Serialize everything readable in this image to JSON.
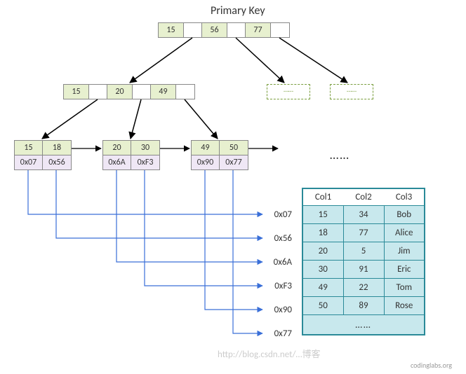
{
  "title": "Primary Key",
  "root_keys": [
    "15",
    "56",
    "77"
  ],
  "internal_keys": [
    "15",
    "20",
    "49"
  ],
  "leaves": [
    {
      "keys": [
        "15",
        "18"
      ],
      "ptrs": [
        "0x07",
        "0x56"
      ]
    },
    {
      "keys": [
        "20",
        "30"
      ],
      "ptrs": [
        "0x6A",
        "0xF3"
      ]
    },
    {
      "keys": [
        "49",
        "50"
      ],
      "ptrs": [
        "0x90",
        "0x77"
      ]
    }
  ],
  "ellipsis_leaf": "……",
  "dashed_label": "……",
  "table": {
    "headers": [
      "Col1",
      "Col2",
      "Col3"
    ],
    "row_labels": [
      "0x07",
      "0x56",
      "0x6A",
      "0xF3",
      "0x90",
      "0x77"
    ],
    "rows": [
      [
        "15",
        "34",
        "Bob"
      ],
      [
        "18",
        "77",
        "Alice"
      ],
      [
        "20",
        "5",
        "Jim"
      ],
      [
        "30",
        "91",
        "Eric"
      ],
      [
        "49",
        "22",
        "Tom"
      ],
      [
        "50",
        "89",
        "Rose"
      ]
    ],
    "footer_ellipsis": "……"
  },
  "watermark": "http://blog.csdn.net/…博客",
  "credit": "codinglabs.org",
  "chart_data": {
    "type": "table",
    "title": "Primary Key B+Tree Secondary-Index -> Row lookup",
    "index_node_keys": {
      "root": [
        15,
        56,
        77
      ],
      "level1_child": [
        15,
        20,
        49
      ]
    },
    "leaf_entries": [
      {
        "key": 15,
        "rowid": "0x07"
      },
      {
        "key": 18,
        "rowid": "0x56"
      },
      {
        "key": 20,
        "rowid": "0x6A"
      },
      {
        "key": 30,
        "rowid": "0xF3"
      },
      {
        "key": 49,
        "rowid": "0x90"
      },
      {
        "key": 50,
        "rowid": "0x77"
      }
    ],
    "row_data": {
      "0x07": {
        "Col1": 15,
        "Col2": 34,
        "Col3": "Bob"
      },
      "0x56": {
        "Col1": 18,
        "Col2": 77,
        "Col3": "Alice"
      },
      "0x6A": {
        "Col1": 20,
        "Col2": 5,
        "Col3": "Jim"
      },
      "0xF3": {
        "Col1": 30,
        "Col2": 91,
        "Col3": "Eric"
      },
      "0x90": {
        "Col1": 49,
        "Col2": 22,
        "Col3": "Tom"
      },
      "0x77": {
        "Col1": 50,
        "Col2": 89,
        "Col3": "Rose"
      }
    }
  }
}
